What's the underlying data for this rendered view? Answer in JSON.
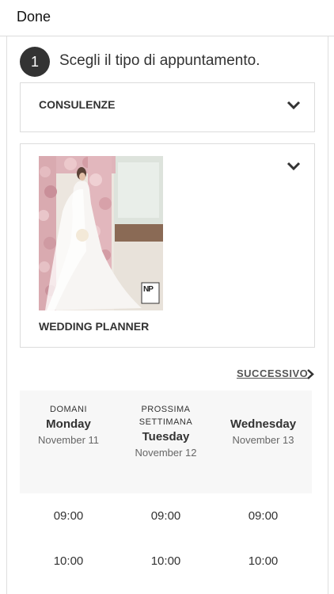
{
  "topbar": {
    "done_label": "Done"
  },
  "step": {
    "number": "1",
    "title": "Scegli il tipo di appuntamento."
  },
  "types": [
    {
      "label": "CONSULENZE"
    },
    {
      "label": "WEDDING PLANNER",
      "image_mark": "NP"
    }
  ],
  "next_label": "SUCCESSIVO",
  "days": [
    {
      "caption": "DOMANI",
      "caption2": "",
      "name": "Monday",
      "date": "November 11"
    },
    {
      "caption": "PROSSIMA",
      "caption2": "SETTIMANA",
      "name": "Tuesday",
      "date": "November 12"
    },
    {
      "caption": "",
      "caption2": "",
      "name": "Wednesday",
      "date": "November 13"
    }
  ],
  "time_rows": [
    [
      "09:00",
      "09:00",
      "09:00"
    ],
    [
      "10:00",
      "10:00",
      "10:00"
    ]
  ]
}
